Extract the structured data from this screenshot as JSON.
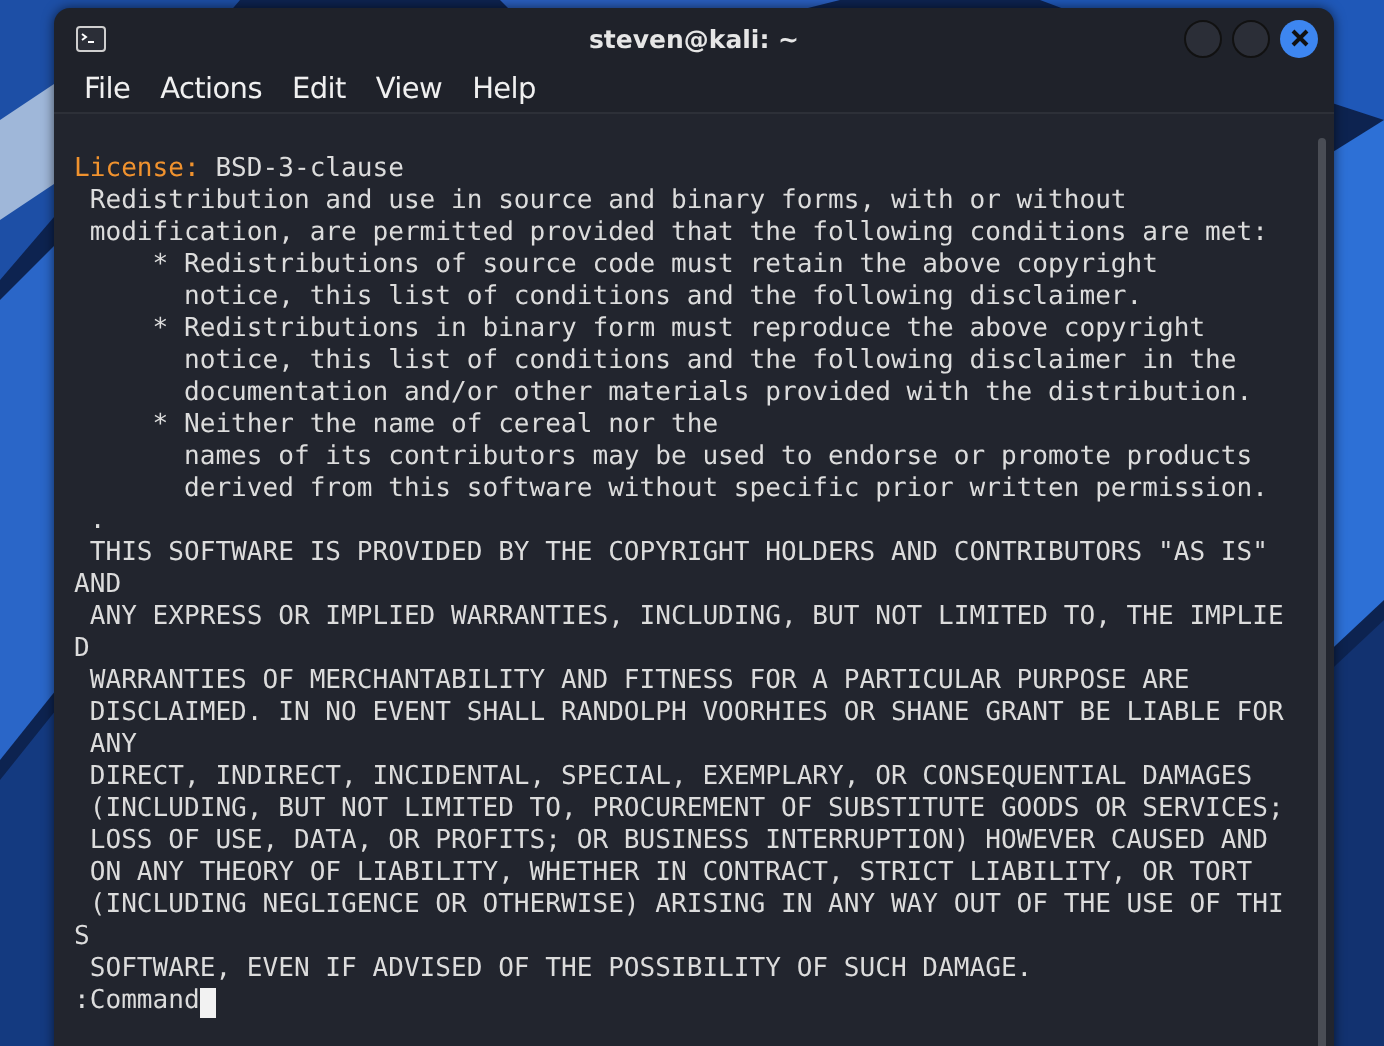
{
  "window": {
    "title": "steven@kali: ~"
  },
  "menu": [
    "File",
    "Actions",
    "Edit",
    "View",
    "Help"
  ],
  "terminal": {
    "lines": [
      {
        "kind": "field",
        "label": "License:",
        "value": "BSD-3-clause"
      },
      {
        "kind": "text",
        "text": " Redistribution and use in source and binary forms, with or without"
      },
      {
        "kind": "text",
        "text": " modification, are permitted provided that the following conditions are met:"
      },
      {
        "kind": "text",
        "text": "     * Redistributions of source code must retain the above copyright"
      },
      {
        "kind": "text",
        "text": "       notice, this list of conditions and the following disclaimer."
      },
      {
        "kind": "text",
        "text": "     * Redistributions in binary form must reproduce the above copyright"
      },
      {
        "kind": "text",
        "text": "       notice, this list of conditions and the following disclaimer in the"
      },
      {
        "kind": "text",
        "text": "       documentation and/or other materials provided with the distribution."
      },
      {
        "kind": "text",
        "text": "     * Neither the name of cereal nor the"
      },
      {
        "kind": "text",
        "text": "       names of its contributors may be used to endorse or promote products"
      },
      {
        "kind": "text",
        "text": "       derived from this software without specific prior written permission."
      },
      {
        "kind": "text",
        "text": " ."
      },
      {
        "kind": "text",
        "text": " THIS SOFTWARE IS PROVIDED BY THE COPYRIGHT HOLDERS AND CONTRIBUTORS \"AS IS\""
      },
      {
        "kind": "text",
        "text": "AND"
      },
      {
        "kind": "text",
        "text": " ANY EXPRESS OR IMPLIED WARRANTIES, INCLUDING, BUT NOT LIMITED TO, THE IMPLIE"
      },
      {
        "kind": "text",
        "text": "D"
      },
      {
        "kind": "text",
        "text": " WARRANTIES OF MERCHANTABILITY AND FITNESS FOR A PARTICULAR PURPOSE ARE"
      },
      {
        "kind": "text",
        "text": " DISCLAIMED. IN NO EVENT SHALL RANDOLPH VOORHIES OR SHANE GRANT BE LIABLE FOR"
      },
      {
        "kind": "text",
        "text": " ANY"
      },
      {
        "kind": "text",
        "text": " DIRECT, INDIRECT, INCIDENTAL, SPECIAL, EXEMPLARY, OR CONSEQUENTIAL DAMAGES"
      },
      {
        "kind": "text",
        "text": " (INCLUDING, BUT NOT LIMITED TO, PROCUREMENT OF SUBSTITUTE GOODS OR SERVICES;"
      },
      {
        "kind": "text",
        "text": " LOSS OF USE, DATA, OR PROFITS; OR BUSINESS INTERRUPTION) HOWEVER CAUSED AND"
      },
      {
        "kind": "text",
        "text": " ON ANY THEORY OF LIABILITY, WHETHER IN CONTRACT, STRICT LIABILITY, OR TORT"
      },
      {
        "kind": "text",
        "text": " (INCLUDING NEGLIGENCE OR OTHERWISE) ARISING IN ANY WAY OUT OF THE USE OF THI"
      },
      {
        "kind": "text",
        "text": "S"
      },
      {
        "kind": "text",
        "text": " SOFTWARE, EVEN IF ADVISED OF THE POSSIBILITY OF SUCH DAMAGE."
      }
    ],
    "prompt": ":Command"
  }
}
